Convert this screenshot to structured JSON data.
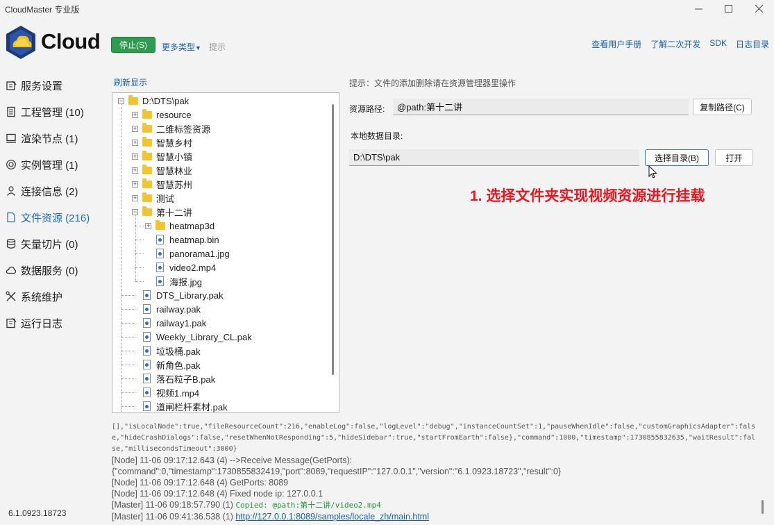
{
  "window": {
    "title": "CloudMaster 专业版",
    "minimize_icon": "minimize-icon",
    "maximize_icon": "maximize-icon",
    "close_icon": "close-icon"
  },
  "header": {
    "logo_text": "Cloud",
    "stop_button": "停止(S)",
    "more_types": "更多类型",
    "hint": "提示",
    "links": [
      "查看用户手册",
      "了解二次开发",
      "SDK",
      "日志目录"
    ]
  },
  "sidebar": {
    "items": [
      {
        "label": "服务设置",
        "icon": "settings-edit-icon"
      },
      {
        "label": "工程管理 (10)",
        "icon": "document-icon"
      },
      {
        "label": "渲染节点 (1)",
        "icon": "monitor-icon"
      },
      {
        "label": "实例管理 (1)",
        "icon": "target-icon"
      },
      {
        "label": "连接信息 (2)",
        "icon": "user-icon"
      },
      {
        "label": "文件资源 (216)",
        "icon": "file-icon",
        "active": true
      },
      {
        "label": "矢量切片 (0)",
        "icon": "database-icon"
      },
      {
        "label": "数据服务 (0)",
        "icon": "cloud-icon"
      },
      {
        "label": "系统维护",
        "icon": "tools-icon"
      },
      {
        "label": "运行日志",
        "icon": "log-icon"
      }
    ]
  },
  "file_panel": {
    "refresh": "刷新显示",
    "tree": {
      "root": "D:\\DTS\\pak",
      "folders": [
        "resource",
        "二维标签资源",
        "智慧乡村",
        "智慧小镇",
        "智慧林业",
        "智慧苏州",
        "测试"
      ],
      "open_folder": "第十二讲",
      "open_folder_children": {
        "folders": [
          "heatmap3d"
        ],
        "files": [
          "heatmap.bin",
          "panorama1.jpg",
          "video2.mp4",
          "海报.jpg"
        ]
      },
      "files": [
        "DTS_Library.pak",
        "railway.pak",
        "railway1.pak",
        "Weekly_Library_CL.pak",
        "垃圾桶.pak",
        "新角色.pak",
        "落石粒子B.pak",
        "视频1.mp4",
        "道闸栏杆素材.pak"
      ]
    }
  },
  "details": {
    "hint": "提示：文件的添加删除请在资源管理器里操作",
    "resource_path_label": "资源路径:",
    "resource_path_value": "@path:第十二讲",
    "copy_path_button": "复制路径(C)",
    "local_dir_label": "本地数据目录:",
    "local_dir_value": "D:\\DTS\\pak",
    "choose_dir_button": "选择目录(B)",
    "open_button": "打开",
    "annotation": "1. 选择文件夹实现视频资源进行挂载"
  },
  "log": {
    "wrap_lines": [
      "[],\"isLocalNode\":true,\"fileResourceCount\":216,\"enableLog\":false,\"logLevel\":\"debug\",\"instanceCountSet\":1,\"pauseWhenIdle\":false,\"customGraphicsAdapter\":fals",
      "e,\"hideCrashDialogs\":false,\"resetWhenNotResponding\":5,\"hideSidebar\":true,\"startFromEarth\":false},\"command\":1000,\"timestamp\":1730855832635,\"waitResult\":fal",
      "se,\"millisecondsTimeout\":3000}"
    ],
    "lines": [
      "[Node] 11-06 09:17:12.643 (4) -->Receive Message(GetPorts):",
      "{\"command\":0,\"timestamp\":1730855832419,\"port\":8089,\"requestIP\":\"127.0.0.1\",\"version\":\"6.1.0923.18723\",\"result\":0}",
      "[Node] 11-06 09:17:12.648 (4) GetPorts: 8089",
      "[Node] 11-06 09:17:12.648 (4) Fixed node ip: 127.0.0.1"
    ],
    "copied_prefix": "[Master] 11-06 09:18:57.790 (1) ",
    "copied_text": "Copied: @path:第十二讲/video2.mp4",
    "link_prefix": "[Master] 11-06 09:41:36.538 (1) ",
    "link_text": "http://127.0.0.1:8089/samples/locale_zh/main.html"
  },
  "footer": {
    "version": "6.1.0923.18723"
  }
}
